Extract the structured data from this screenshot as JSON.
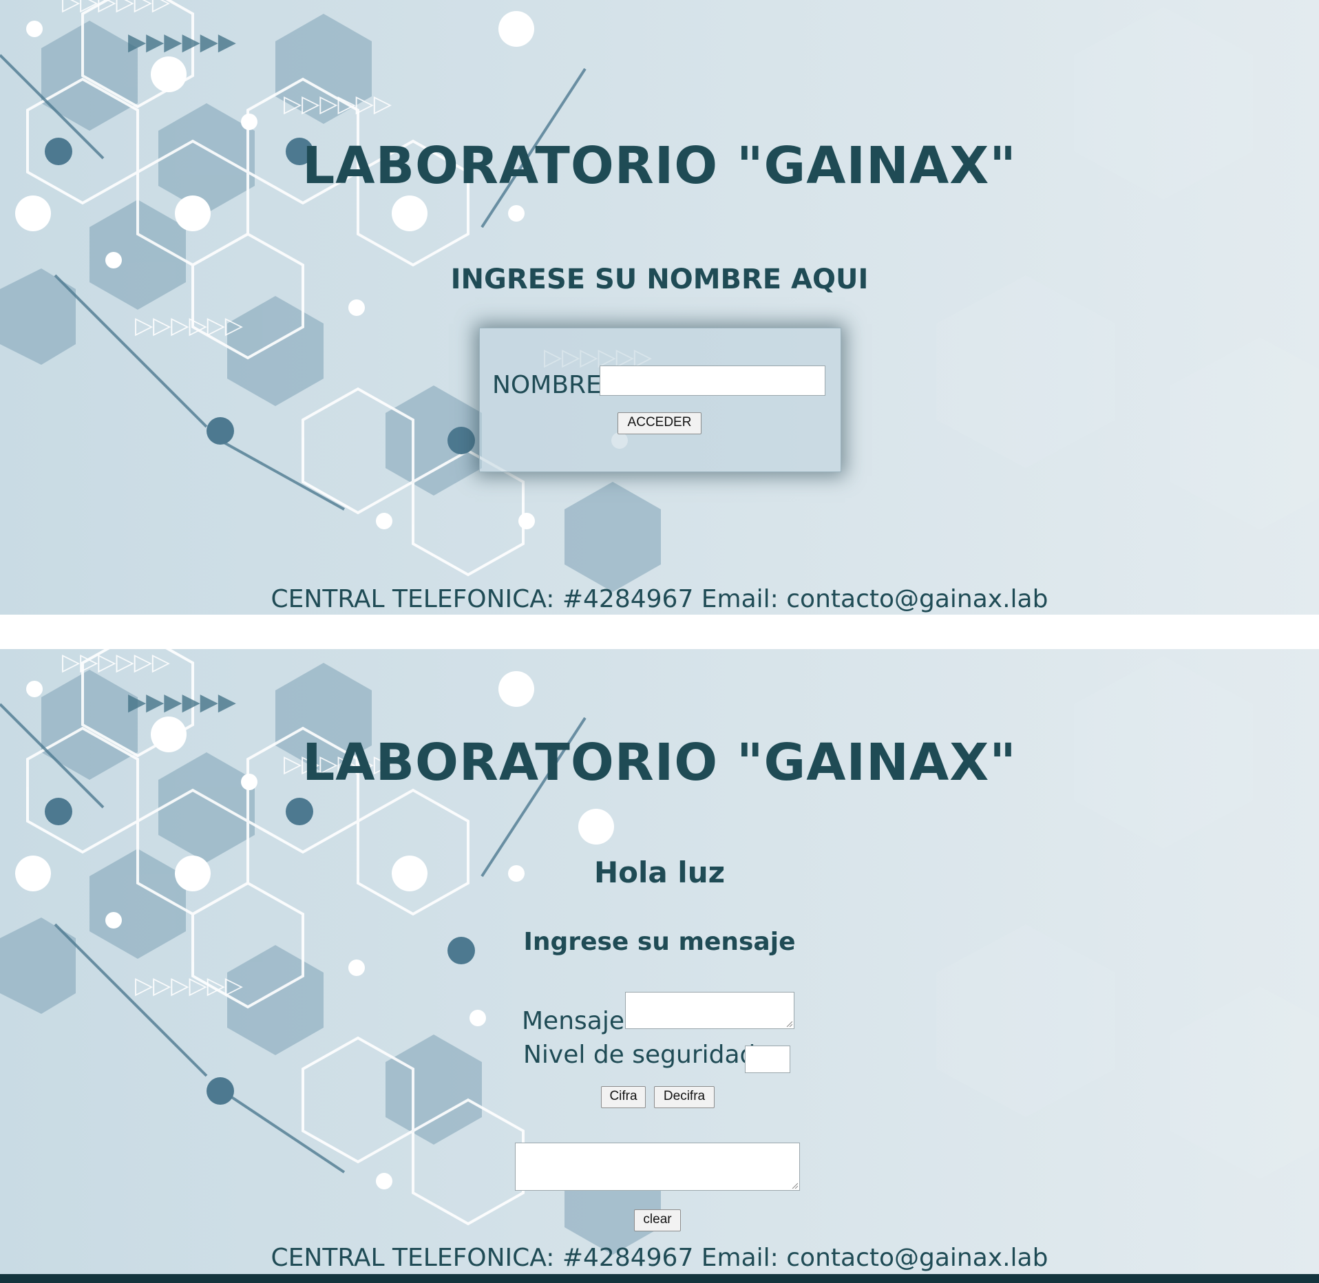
{
  "login": {
    "title": "LABORATORIO \"GAINAX\"",
    "subtitle": "INGRESE SU NOMBRE AQUI",
    "name_label": "NOMBRE",
    "name_value": "",
    "submit_label": "ACCEDER",
    "footer": "CENTRAL TELEFONICA: #4284967 Email: contacto@gainax.lab"
  },
  "app": {
    "title": "LABORATORIO \"GAINAX\"",
    "greeting": "Hola luz",
    "prompt": "Ingrese su mensaje",
    "message_label": "Mensaje",
    "message_value": "",
    "security_label": "Nivel de seguridad",
    "security_value": "",
    "cipher_label": "Cifra",
    "decipher_label": "Decifra",
    "output_value": "",
    "clear_label": "clear",
    "footer": "CENTRAL TELEFONICA: #4284967 Email: contacto@gainax.lab"
  },
  "colors": {
    "text": "#1f4b55",
    "background": "#d3e1e8",
    "hexagon": "#7fa3b6"
  }
}
